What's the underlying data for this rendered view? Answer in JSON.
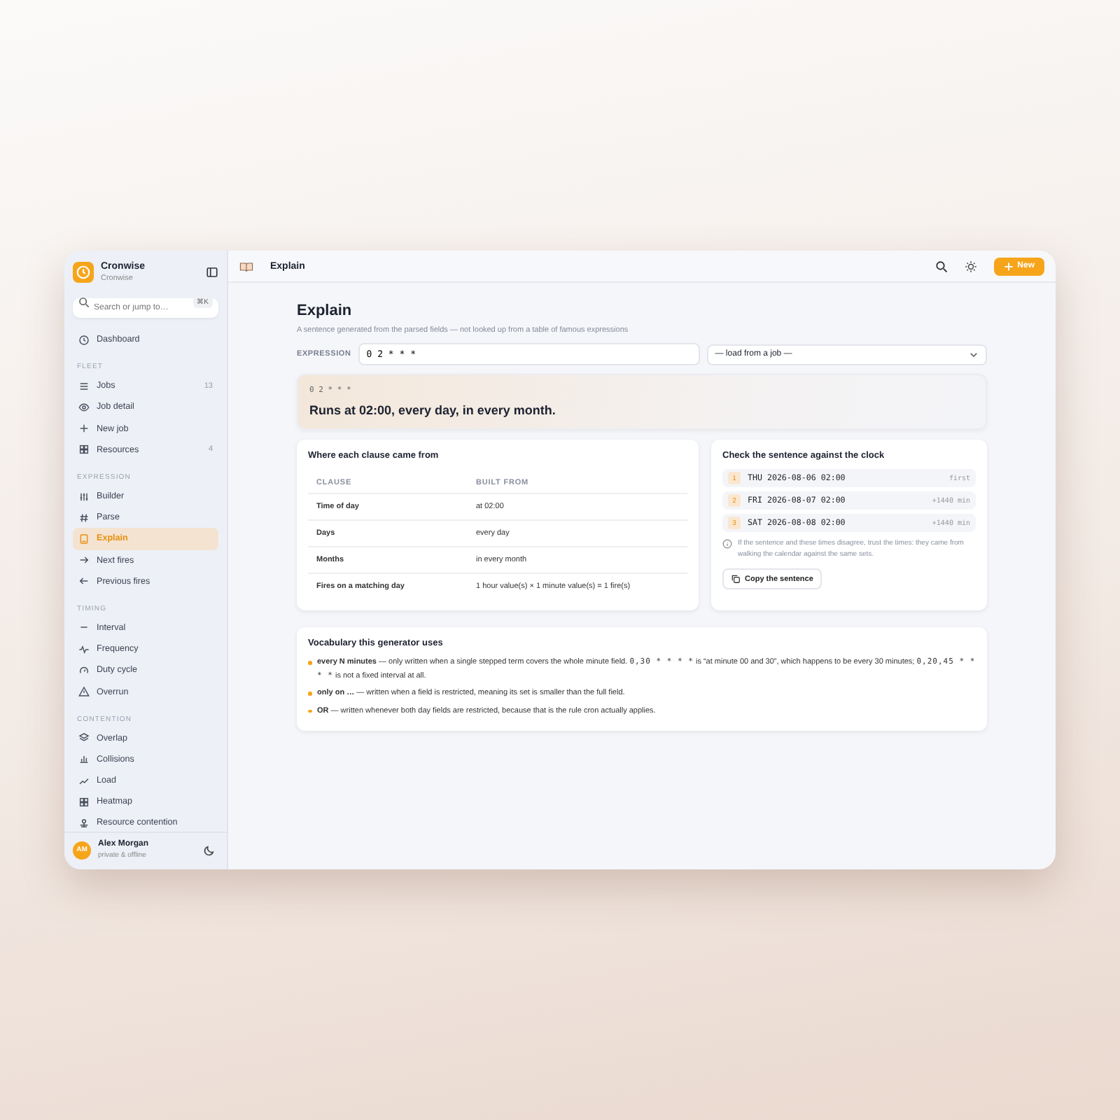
{
  "app": {
    "name": "Cronwise",
    "subtitle": "Cronwise"
  },
  "search": {
    "placeholder": "Search or jump to…",
    "shortcut": "⌘K"
  },
  "nav": [
    {
      "items": [
        {
          "label": "Dashboard",
          "selected": false
        }
      ]
    },
    {
      "heading": "FLEET",
      "items": [
        {
          "label": "Jobs",
          "count": "13",
          "selected": false
        },
        {
          "label": "Job detail",
          "selected": false
        },
        {
          "label": "New job",
          "selected": false
        },
        {
          "label": "Resources",
          "count": "4",
          "selected": false
        }
      ]
    },
    {
      "heading": "EXPRESSION",
      "items": [
        {
          "label": "Builder",
          "selected": false
        },
        {
          "label": "Parse",
          "selected": false
        },
        {
          "label": "Explain",
          "selected": true
        },
        {
          "label": "Next fires",
          "selected": false
        },
        {
          "label": "Previous fires",
          "selected": false
        }
      ]
    },
    {
      "heading": "TIMING",
      "items": [
        {
          "label": "Interval",
          "selected": false
        },
        {
          "label": "Frequency",
          "selected": false
        },
        {
          "label": "Duty cycle",
          "selected": false
        },
        {
          "label": "Overrun",
          "selected": false
        }
      ]
    },
    {
      "heading": "CONTENTION",
      "items": [
        {
          "label": "Overlap",
          "selected": false
        },
        {
          "label": "Collisions",
          "selected": false
        },
        {
          "label": "Load",
          "selected": false
        },
        {
          "label": "Heatmap",
          "selected": false
        },
        {
          "label": "Resource contention",
          "selected": false
        }
      ]
    }
  ],
  "user": {
    "initials": "AM",
    "name": "Alex Morgan",
    "status": "private & offline"
  },
  "topbar": {
    "title": "Explain",
    "new_button": "New"
  },
  "page": {
    "title": "Explain",
    "subtitle": "A sentence generated from the parsed fields — not looked up from a table of famous expressions"
  },
  "expression": {
    "label": "EXPRESSION",
    "value": "0 2 * * *",
    "job_select": "— load from a job —"
  },
  "result": {
    "expression": "0 2 * * *",
    "sentence": "Runs at 02:00, every day, in every month."
  },
  "clauses": {
    "title": "Where each clause came from",
    "columns": [
      "CLAUSE",
      "BUILT FROM"
    ],
    "rows": [
      {
        "clause": "Time of day",
        "built_from": "at 02:00"
      },
      {
        "clause": "Days",
        "built_from": "every day"
      },
      {
        "clause": "Months",
        "built_from": "in every month"
      },
      {
        "clause": "Fires on a matching day",
        "built_from": "1 hour value(s) × 1 minute value(s) = 1 fire(s)"
      }
    ]
  },
  "clock": {
    "title": "Check the sentence against the clock",
    "fires": [
      {
        "index": "1",
        "time": "THU 2026-08-06 02:00",
        "delta": "first"
      },
      {
        "index": "2",
        "time": "FRI 2026-08-07 02:00",
        "delta": "+1440 min"
      },
      {
        "index": "3",
        "time": "SAT 2026-08-08 02:00",
        "delta": "+1440 min"
      }
    ],
    "note": "If the sentence and these times disagree, trust the times: they came from walking the calendar against the same sets.",
    "copy_button": "Copy the sentence"
  },
  "vocabulary": {
    "title": "Vocabulary this generator uses",
    "items": [
      {
        "term": "every N minutes",
        "parts": [
          {
            "kind": "text",
            "text": " — only written when a single stepped term covers the whole minute field. "
          },
          {
            "kind": "code",
            "text": "0,30 * * * *"
          },
          {
            "kind": "text",
            "text": " is “at minute 00 and 30”, which happens to be every 30 minutes; "
          },
          {
            "kind": "code",
            "text": "0,20,45 * * * *"
          },
          {
            "kind": "text",
            "text": " is not a fixed interval at all."
          }
        ]
      },
      {
        "term": "only on …",
        "parts": [
          {
            "kind": "text",
            "text": " — written when a field is restricted, meaning its set is smaller than the full field."
          }
        ]
      },
      {
        "term": "OR",
        "parts": [
          {
            "kind": "text",
            "text": " — written whenever both day fields are restricted, because that is the rule cron actually applies."
          }
        ]
      }
    ]
  }
}
